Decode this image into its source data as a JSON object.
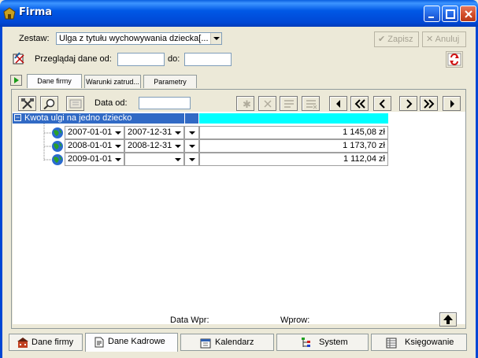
{
  "window": {
    "title": "Firma"
  },
  "top": {
    "zestaw_label": "Zestaw:",
    "zestaw_value": "Ulga z tytułu wychowywania dziecka[...",
    "zapisz": "✔ Zapisz",
    "anuluj": "✕ Anuluj",
    "przegladaj_label": "Przeglądaj dane od:",
    "do_label": "do:",
    "od_value": "",
    "do_value": ""
  },
  "tabs": [
    "Dane firmy",
    "Warunki zatrud...",
    "Parametry"
  ],
  "toolbar": {
    "data_od_label": "Data od:",
    "data_od_value": ""
  },
  "grid": {
    "header": "Kwota ulgi na jedno dziecko",
    "rows": [
      {
        "from": "2007-01-01",
        "to": "2007-12-31",
        "value": "1 145,08 zł"
      },
      {
        "from": "2008-01-01",
        "to": "2008-12-31",
        "value": "1 173,70 zł"
      },
      {
        "from": "2009-01-01",
        "to": "",
        "value": "1 112,04 zł"
      }
    ]
  },
  "footer": {
    "data_wpr": "Data Wpr:",
    "wprow": "Wprow:"
  },
  "bottom_tabs": [
    "Dane firmy",
    "Dane Kadrowe",
    "Kalendarz",
    "System",
    "Księgowanie"
  ],
  "colors": {
    "accent": "#316ac5",
    "highlight": "#00ffff",
    "titlebar": "#0058e6"
  }
}
